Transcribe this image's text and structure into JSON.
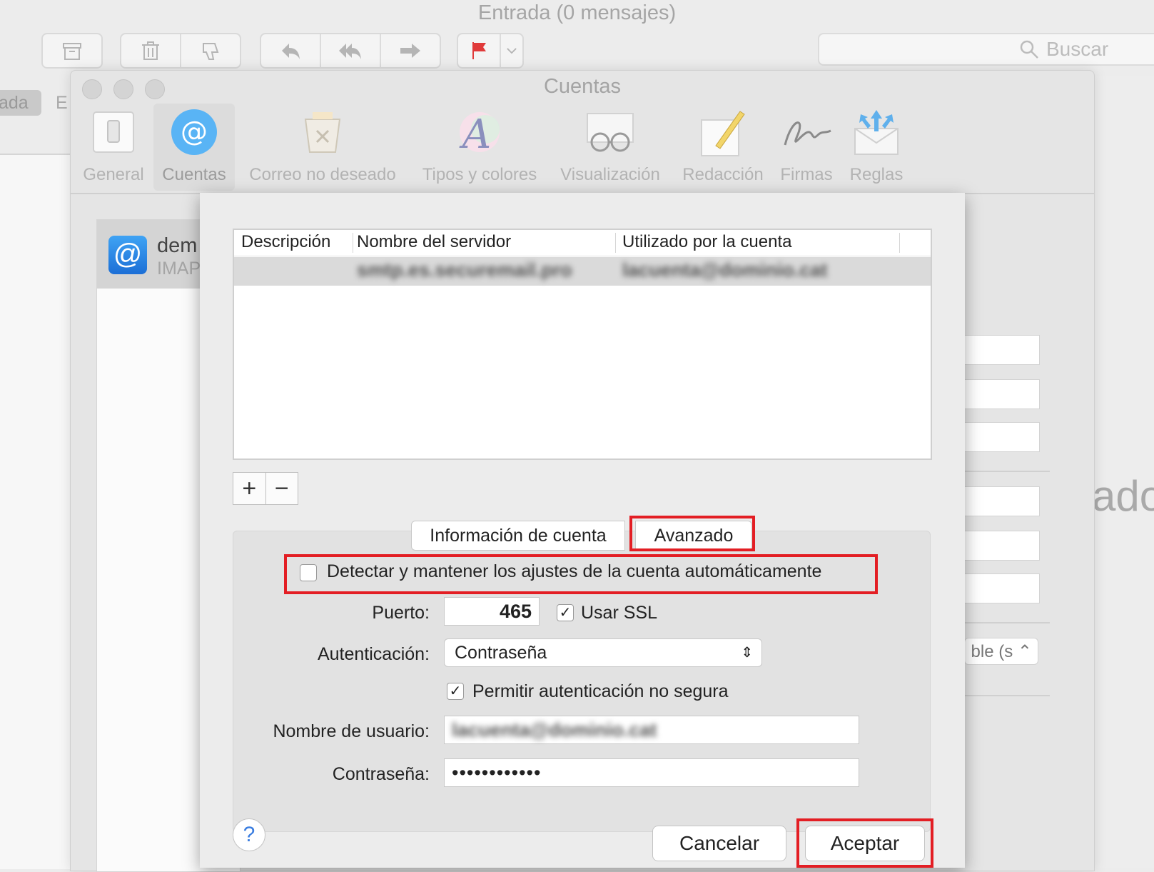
{
  "main_window": {
    "title": "Entrada (0 mensajes)",
    "search_placeholder": "Buscar",
    "favorites": [
      "ada",
      "E"
    ],
    "background_partial_text": "ado"
  },
  "prefs": {
    "title": "Cuentas",
    "toolbar": [
      {
        "label": "General",
        "icon": "switch-icon"
      },
      {
        "label": "Cuentas",
        "icon": "at-icon"
      },
      {
        "label": "Correo no deseado",
        "icon": "trash-junk-icon"
      },
      {
        "label": "Tipos y colores",
        "icon": "fonts-colors-icon"
      },
      {
        "label": "Visualización",
        "icon": "glasses-icon"
      },
      {
        "label": "Redacción",
        "icon": "pencil-icon"
      },
      {
        "label": "Firmas",
        "icon": "signature-icon"
      },
      {
        "label": "Reglas",
        "icon": "rules-envelope-icon"
      }
    ],
    "account": {
      "name": "dem",
      "type": "IMAP"
    },
    "bg_select_text": "ble (s"
  },
  "sheet": {
    "columns": [
      "Descripción",
      "Nombre del servidor",
      "Utilizado por la cuenta"
    ],
    "rows": [
      {
        "description": "",
        "server": "smtp.es.securemail.pro",
        "account": "lacuenta@dominio.cat"
      }
    ],
    "add_label": "+",
    "remove_label": "−",
    "tabs": [
      "Información de cuenta",
      "Avanzado"
    ],
    "auto_detect_label": "Detectar y mantener los ajustes de la cuenta automáticamente",
    "auto_detect_checked": false,
    "port_label": "Puerto:",
    "port_value": "465",
    "ssl_label": "Usar SSL",
    "ssl_checked": true,
    "auth_label": "Autenticación:",
    "auth_value": "Contraseña",
    "insecure_label": "Permitir autenticación no segura",
    "insecure_checked": true,
    "username_label": "Nombre de usuario:",
    "username_value": "lacuenta@dominio.cat",
    "password_label": "Contraseña:",
    "password_value": "••••••••••••",
    "help_label": "?",
    "cancel_label": "Cancelar",
    "ok_label": "Aceptar",
    "highlight_color": "#e31e24"
  }
}
